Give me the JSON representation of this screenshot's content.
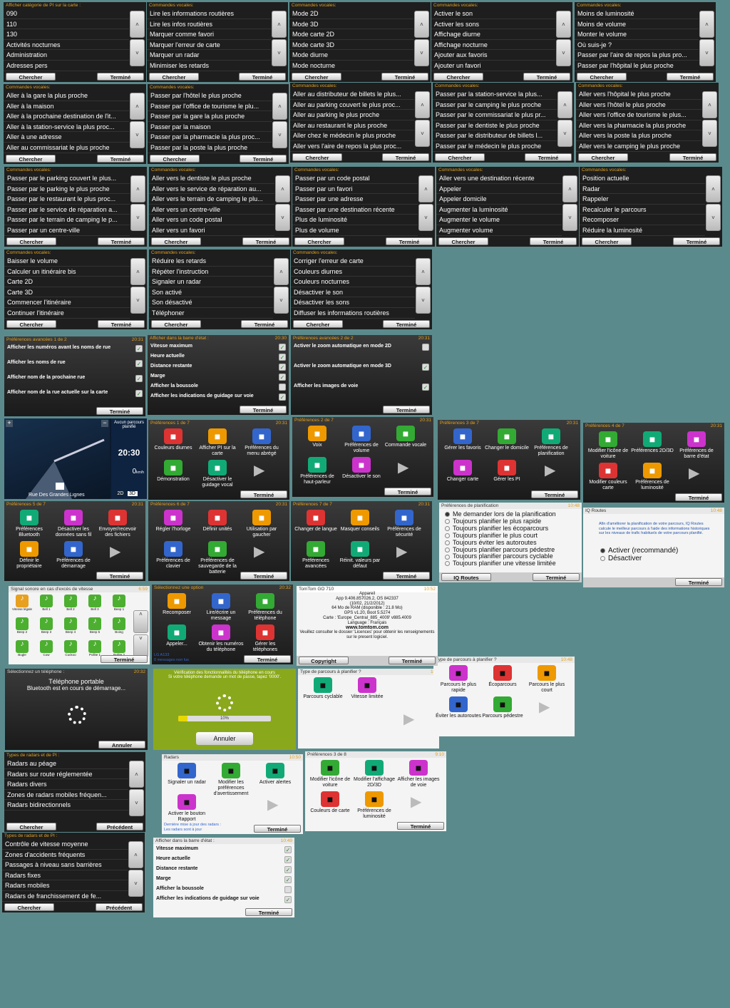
{
  "lists": [
    {
      "id": "l1",
      "head": "Afficher catégorie de PI sur la carte :",
      "items": [
        "090",
        "110",
        "130",
        "Activités nocturnes",
        "Administration",
        "Adresses pers"
      ],
      "left": "Chercher",
      "right": "Terminé"
    },
    {
      "id": "l2",
      "head": "Commandes vocales:",
      "items": [
        "Lire les informations routières",
        "Lire les infos routières",
        "Marquer comme favori",
        "Marquer l'erreur de carte",
        "Marquer un radar",
        "Minimiser les retards"
      ],
      "left": "Chercher",
      "right": "Terminé"
    },
    {
      "id": "l3",
      "head": "Commandes vocales:",
      "items": [
        "Mode 2D",
        "Mode 3D",
        "Mode carte 2D",
        "Mode carte 3D",
        "Mode diurne",
        "Mode nocturne"
      ],
      "left": "Chercher",
      "right": "Terminé"
    },
    {
      "id": "l4",
      "head": "Commandes vocales:",
      "items": [
        "Activer le son",
        "Activer les sons",
        "Affichage diurne",
        "Affichage nocturne",
        "Ajouter aux favoris",
        "Ajouter un favori"
      ],
      "left": "Chercher",
      "right": "Terminé"
    },
    {
      "id": "l5",
      "head": "Commandes vocales:",
      "items": [
        "Moins de luminosité",
        "Moins de volume",
        "Monter le volume",
        "Où suis-je ?",
        "Passer par l'aire de repos la plus pro...",
        "Passer par l'hôpital le plus proche"
      ],
      "left": "Chercher",
      "right": "Terminé"
    },
    {
      "id": "l6",
      "head": "Commandes vocales:",
      "items": [
        "Aller à la gare la plus proche",
        "Aller à la maison",
        "Aller à la prochaine destination de l'it...",
        "Aller à la station-service la plus proc...",
        "Aller à une adresse",
        "Aller au commissariat le plus proche"
      ],
      "left": "Chercher",
      "right": "Terminé"
    },
    {
      "id": "l7",
      "head": "Commandes vocales:",
      "items": [
        "Passer par l'hôtel le plus proche",
        "Passer par l'office de tourisme le plu...",
        "Passer par la gare la plus proche",
        "Passer par la maison",
        "Passer par la pharmacie la plus proc...",
        "Passer par la poste la plus proche"
      ],
      "left": "Chercher",
      "right": "Terminé"
    },
    {
      "id": "l8",
      "head": "Commandes vocales:",
      "items": [
        "Aller au distributeur de billets le plus...",
        "Aller au parking couvert le plus proc...",
        "Aller au parking le plus proche",
        "Aller au restaurant le plus proche",
        "Aller chez le médecin le plus proche",
        "Aller vers l'aire de repos la plus proc..."
      ],
      "left": "Chercher",
      "right": "Terminé"
    },
    {
      "id": "l9",
      "head": "Commandes vocales:",
      "items": [
        "Passer par la station-service la plus...",
        "Passer par le camping le plus proche",
        "Passer par le commissariat le plus pr...",
        "Passer par le dentiste le plus proche",
        "Passer par le distributeur de billets l...",
        "Passer par le médecin le plus proche"
      ],
      "left": "Chercher",
      "right": "Terminé"
    },
    {
      "id": "l10",
      "head": "Commandes vocales:",
      "items": [
        "Aller vers l'hôpital le plus proche",
        "Aller vers l'hôtel le plus proche",
        "Aller vers l'office de tourisme le plus...",
        "Aller vers la pharmacie la plus proche",
        "Aller vers la poste la plus proche",
        "Aller vers le camping le plus proche"
      ],
      "left": "Chercher",
      "right": "Terminé"
    },
    {
      "id": "l11",
      "head": "Commandes vocales:",
      "items": [
        "Passer par le parking couvert le plus...",
        "Passer par le parking le plus proche",
        "Passer par le restaurant le plus proc...",
        "Passer par le service de réparation a...",
        "Passer par le terrain de camping le p...",
        "Passer par un centre-ville"
      ],
      "left": "Chercher",
      "right": "Terminé"
    },
    {
      "id": "l12",
      "head": "Commandes vocales:",
      "items": [
        "Aller vers le dentiste le plus proche",
        "Aller vers le service de réparation au...",
        "Aller vers le terrain de camping le plu...",
        "Aller vers un centre-ville",
        "Aller vers un code postal",
        "Aller vers un favori"
      ],
      "left": "Chercher",
      "right": "Terminé"
    },
    {
      "id": "l13",
      "head": "Commandes vocales:",
      "items": [
        "Passer par un code postal",
        "Passer par un favori",
        "Passer par une adresse",
        "Passer par une destination récente",
        "Plus de luminosité",
        "Plus de volume"
      ],
      "left": "Chercher",
      "right": "Terminé"
    },
    {
      "id": "l14",
      "head": "Commandes vocales:",
      "items": [
        "Aller vers une destination récente",
        "Appeler",
        "Appeler domicile",
        "Augmenter la luminosité",
        "Augmenter le volume",
        "Augmenter volume"
      ],
      "left": "Chercher",
      "right": "Terminé"
    },
    {
      "id": "l15",
      "head": "Commandes vocales:",
      "items": [
        "Position actuelle",
        "Radar",
        "Rappeler",
        "Recalculer le parcours",
        "Recomposer",
        "Réduire la luminosité"
      ],
      "left": "Chercher",
      "right": "Terminé"
    },
    {
      "id": "l16",
      "head": "Commandes vocales:",
      "items": [
        "Baisser le volume",
        "Calculer un itinéraire bis",
        "Carte 2D",
        "Carte 3D",
        "Commencer l'itinéraire",
        "Continuer l'itinéraire"
      ],
      "left": "Chercher",
      "right": "Terminé"
    },
    {
      "id": "l17",
      "head": "Commandes vocales:",
      "items": [
        "Réduire les retards",
        "Répéter l'instruction",
        "Signaler un radar",
        "Son activé",
        "Son désactivé",
        "Téléphoner"
      ],
      "left": "Chercher",
      "right": "Terminé"
    },
    {
      "id": "l18",
      "head": "Commandes vocales:",
      "items": [
        "Corriger l'erreur de carte",
        "Couleurs diurnes",
        "Couleurs nocturnes",
        "Désactiver le son",
        "Désactiver les sons",
        "Diffuser les informations routières"
      ],
      "left": "Chercher",
      "right": "Terminé"
    },
    {
      "id": "l19",
      "head": "Types de radars et de PI :",
      "items": [
        "Radars au péage",
        "Radars sur route réglementée",
        "Radars divers",
        "Zones de radars mobiles fréquen...",
        "Radars bidirectionnels"
      ],
      "left": "Chercher",
      "right": "Précédent"
    },
    {
      "id": "l20",
      "head": "Types de radars et de PI :",
      "items": [
        "Contrôle de vitesse moyenne",
        "Zones d'accidents fréquents",
        "Passages à niveau sans barrières",
        "Radars fixes",
        "Radars mobiles",
        "Radars de franchissement de fe..."
      ],
      "left": "Chercher",
      "right": "Précédent"
    }
  ],
  "checks": [
    {
      "head": "Préférences avancées 1 de 2",
      "time": "20:31",
      "items": [
        {
          "t": "Afficher les numéros avant les noms de rue",
          "c": true
        },
        {
          "t": "Afficher les noms de rue",
          "c": true
        },
        {
          "t": "Afficher nom de la prochaine rue",
          "c": true
        },
        {
          "t": "Afficher nom de la rue actuelle sur la carte",
          "c": true
        }
      ],
      "btn": "Terminé"
    },
    {
      "head": "Afficher dans la barre d'état :",
      "time": "20:30",
      "items": [
        {
          "t": "Vitesse maximum",
          "c": true
        },
        {
          "t": "Heure actuelle",
          "c": true
        },
        {
          "t": "Distance restante",
          "c": true
        },
        {
          "t": "Marge",
          "c": true
        },
        {
          "t": "Afficher la boussole",
          "c": false
        },
        {
          "t": "Afficher les indications de guidage sur voie",
          "c": true
        }
      ],
      "btn": "Terminé"
    },
    {
      "head": "Préférences avancées 2 de 2",
      "time": "20:31",
      "items": [
        {
          "t": "Activer le zoom automatique en mode 2D",
          "c": false
        },
        {
          "t": "Activer le zoom automatique en mode 3D",
          "c": true
        },
        {
          "t": "Afficher les images de voie",
          "c": true
        }
      ],
      "btn": "Terminé"
    },
    {
      "head": "Afficher dans la barre d'état :",
      "time": "10:49",
      "items": [
        {
          "t": "Vitesse maximum",
          "c": true
        },
        {
          "t": "Heure actuelle",
          "c": true
        },
        {
          "t": "Distance restante",
          "c": true
        },
        {
          "t": "Marge",
          "c": true
        },
        {
          "t": "Afficher la boussole",
          "c": false
        },
        {
          "t": "Afficher les indications de guidage sur voie",
          "c": true
        }
      ],
      "btn": "Terminé"
    }
  ],
  "map": {
    "status": "Aucun parcours planifié",
    "time": "20:30",
    "speed": "0",
    "unit": "km/h",
    "street": "Rue Des Grandes Lignes",
    "d2": "2D",
    "d3": "3D"
  },
  "grids": [
    {
      "head": "Préférences 1 de 7",
      "time": "20:31",
      "items": [
        "Couleurs diurnes",
        "Afficher PI sur la carte",
        "Préférences du menu abrégé",
        "Démonstration",
        "Désactiver le guidage vocal"
      ],
      "btn": "Terminé"
    },
    {
      "head": "Préférences 2 de 7",
      "time": "20:31",
      "items": [
        "Voix",
        "Préférences de volume",
        "Commande vocale",
        "Préférences de haut-parleur",
        "Désactiver le son"
      ],
      "btn": "Terminé"
    },
    {
      "head": "Préférences 3 de 7",
      "time": "20:31",
      "items": [
        "Gérer les favoris",
        "Changer le domicile",
        "Préférences de planification",
        "Changer carte",
        "Gérer les PI"
      ],
      "btn": "Terminé"
    },
    {
      "head": "Préférences 4 de 7",
      "time": "20:31",
      "items": [
        "Modifier l'icône de voiture",
        "Préférences 2D/3D",
        "Préférences de barre d'état",
        "Modifier couleurs carte",
        "Préférences de luminosité"
      ],
      "btn": "Terminé"
    },
    {
      "head": "Préférences 5 de 7",
      "time": "20:31",
      "items": [
        "Préférences Bluetooth",
        "Désactiver les données sans fil",
        "Envoyer/recevoir des fichiers",
        "Définir le propriétaire",
        "Préférences de démarrage"
      ],
      "btn": "Terminé"
    },
    {
      "head": "Préférences 6 de 7",
      "time": "20:31",
      "items": [
        "Régler l'horloge",
        "Définir unités",
        "Utilisation par gaucher",
        "Préférences de clavier",
        "Préférences de sauvegarde de la batterie"
      ],
      "btn": "Terminé"
    },
    {
      "head": "Préférences 7 de 7",
      "time": "20:31",
      "items": [
        "Changer de langue",
        "Masquer conseils",
        "Préférences de sécurité",
        "Préférences avancées",
        "Réinit. valeurs par défaut"
      ],
      "btn": "Terminé"
    },
    {
      "head": "Sélectionnez une option",
      "time": "20:32",
      "items": [
        "Recomposer",
        "Lire/écrire un message",
        "Préférences du téléphone",
        "Appeler...",
        "Obtenir les numéros du téléphone",
        "Gérer les téléphones"
      ],
      "btn": "Terminé",
      "footer1": "LG A133",
      "footer2": "0 messages non lus"
    },
    {
      "head": "Radars",
      "time": "10:50",
      "items": [
        "Signaler un radar",
        "Modifier les préférences d'avertissement",
        "Activer alertes",
        "Activer le bouton Rapport"
      ],
      "btn": "Terminé",
      "footer1": "Dernière mise à jour des radars :",
      "footer2": "Les radars sont à jour"
    },
    {
      "head": "Préférences 3 de 8",
      "time": "9:10",
      "items": [
        "Modifier l'icône de voiture",
        "Modifier l'affichage 2D/3D",
        "Afficher les images de voie",
        "Couleurs de carte",
        "Préférences de luminosité"
      ],
      "btn": "Terminé"
    },
    {
      "head": "Type de parcours à planifier ?",
      "time": "10:",
      "items": [
        "Parcours cyclable",
        "Vitesse limitée"
      ],
      "btn": ""
    },
    {
      "head": "Type de parcours à planifier ?",
      "time": "10:48",
      "items": [
        "Parcours le plus rapide",
        "Écoparcours",
        "Parcours le plus court",
        "Éviter les autoroutes",
        "Parcours pédestre"
      ],
      "btn": ""
    }
  ],
  "plan": {
    "head": "Préférences de planification",
    "time": "10:48",
    "items": [
      "Me demander lors de la planification",
      "Toujours planifier le plus rapide",
      "Toujours planifier les écoparcours",
      "Toujours planifier le plus court",
      "Toujours éviter les autoroutes",
      "Toujours planifier parcours pédestre",
      "Toujours planifier parcours cyclable",
      "Toujours planifier une vitesse limitée"
    ],
    "left": "IQ Routes",
    "right": "Terminé"
  },
  "iq": {
    "head": "IQ Routes",
    "time": "10:48",
    "text": "Afin d'améliorer la planification de votre parcours, IQ Routes calcule le meilleur parcours à l'aide des informations historiques sur les niveaux de trafic habituels de votre parcours planifié.",
    "opt1": "Activer (recommandé)",
    "opt2": "Désactiver",
    "btn": "Terminé"
  },
  "sound": {
    "head": "Signal sonore en cas d'excès de vitesse",
    "time": "6:59",
    "items": [
      "Vitesse légale",
      "Bell 1",
      "Bell 2",
      "Bell 3",
      "Beep 1",
      "Beep 2",
      "Beep 3",
      "Beep 4",
      "Beep 5",
      "Boing",
      "Bugle",
      "Cow",
      "Cuckoo",
      "Pollite 1",
      "Pollite 2"
    ],
    "btn": "Terminé"
  },
  "about": {
    "head": "TomTom GO 710",
    "time": "10:52",
    "lines": [
      "Appareil",
      "App 9.406.857026.2, OS 842337",
      "(10/02, 21/2/2012)",
      "64 Mo de RAM  (disponible : 21.8 Mo)",
      "GPS v1.20, Boot 5.5274",
      "Carte : 'Europe_Central_885_4009' v885.4009",
      "Language : Français",
      "www.tomtom.com",
      "Veuillez consulter le dossier 'Licences' pour obtenir les renseignements sur le present logiciel."
    ],
    "left": "Copyright",
    "right": "Terminé"
  },
  "phone": {
    "head": "Sélectionnez un téléphone :",
    "time": "20:32",
    "l1": "Téléphone portable",
    "l2": "Bluetooth est en cours de démarrage...",
    "btn": "Annuler"
  },
  "verif": {
    "l1": "Vérification des fonctionnalités du téléphone en cours",
    "l2": "Si votre téléphone demande un mot de passe, tapez '0000'.",
    "pct": "10%",
    "progress": 0.1,
    "btn": "Annuler"
  }
}
